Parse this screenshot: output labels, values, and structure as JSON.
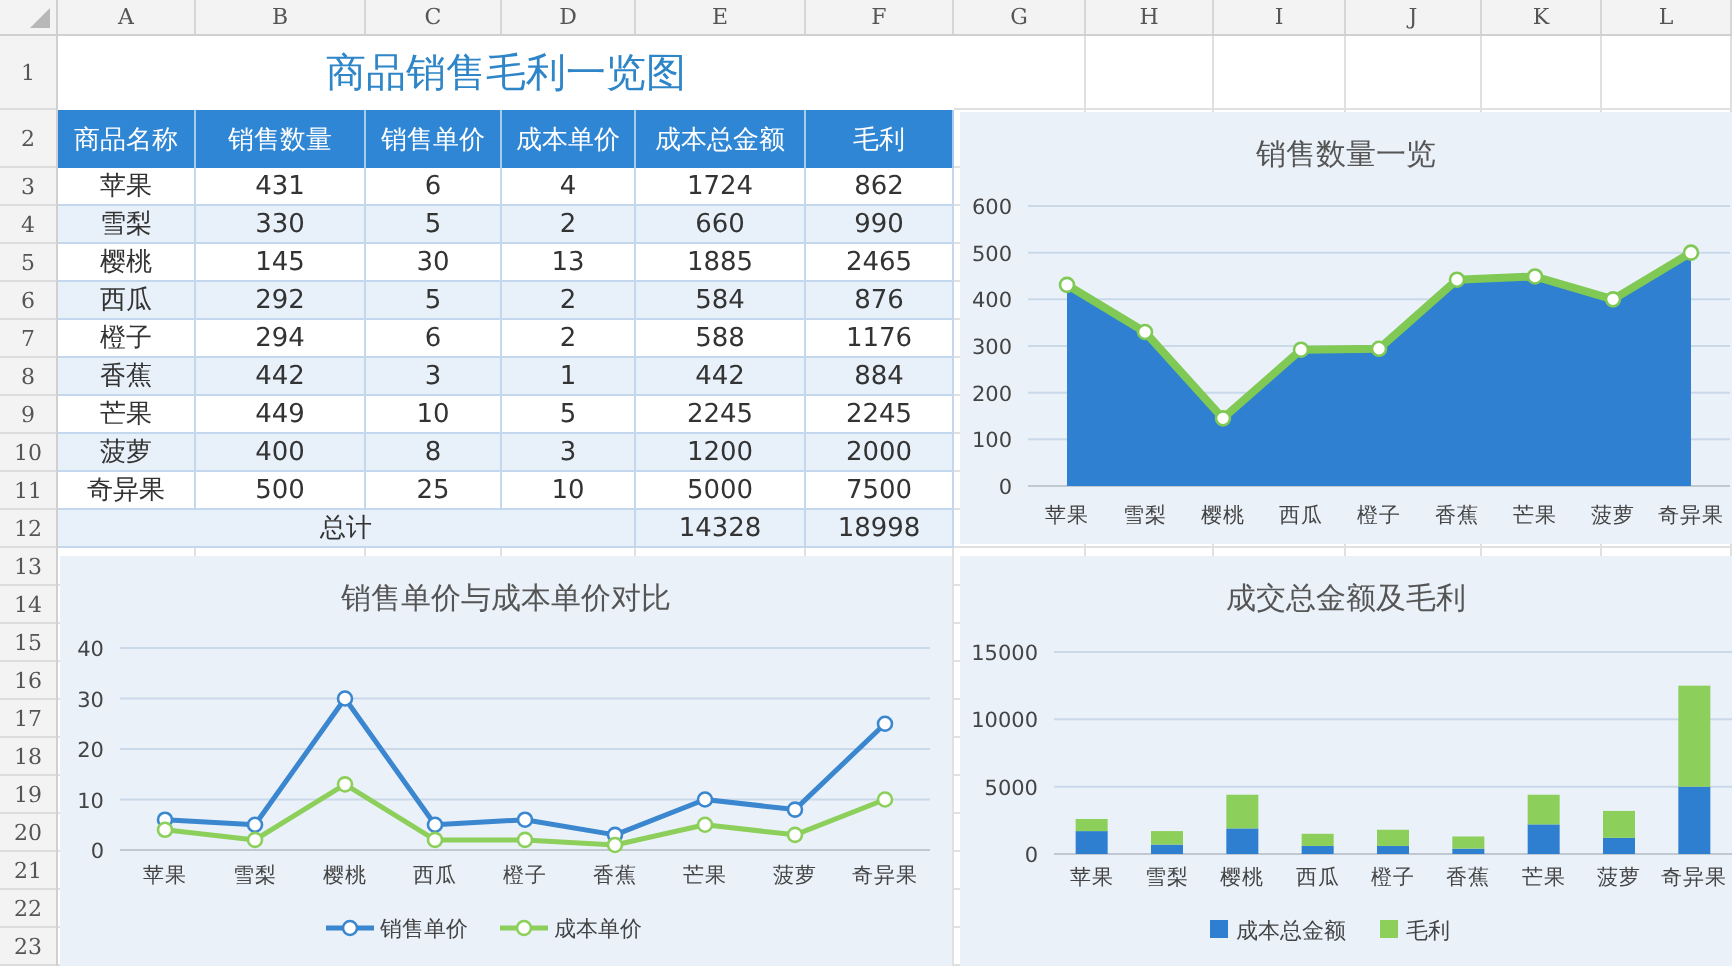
{
  "column_headers": [
    "A",
    "B",
    "C",
    "D",
    "E",
    "F",
    "G",
    "H",
    "I",
    "J",
    "K",
    "L"
  ],
  "row_headers": [
    "1",
    "2",
    "3",
    "4",
    "5",
    "6",
    "7",
    "8",
    "9",
    "10",
    "11",
    "12",
    "13",
    "14",
    "15",
    "16",
    "17",
    "18",
    "19",
    "20",
    "21",
    "22",
    "23"
  ],
  "sheet_title": "商品销售毛利一览图",
  "table": {
    "columns": [
      "商品名称",
      "销售数量",
      "销售单价",
      "成本单价",
      "成本总金额",
      "毛利"
    ],
    "rows": [
      [
        "苹果",
        "431",
        "6",
        "4",
        "1724",
        "862"
      ],
      [
        "雪梨",
        "330",
        "5",
        "2",
        "660",
        "990"
      ],
      [
        "樱桃",
        "145",
        "30",
        "13",
        "1885",
        "2465"
      ],
      [
        "西瓜",
        "292",
        "5",
        "2",
        "584",
        "876"
      ],
      [
        "橙子",
        "294",
        "6",
        "2",
        "588",
        "1176"
      ],
      [
        "香蕉",
        "442",
        "3",
        "1",
        "442",
        "884"
      ],
      [
        "芒果",
        "449",
        "10",
        "5",
        "2245",
        "2245"
      ],
      [
        "菠萝",
        "400",
        "8",
        "3",
        "1200",
        "2000"
      ],
      [
        "奇异果",
        "500",
        "25",
        "10",
        "5000",
        "7500"
      ]
    ],
    "total": {
      "label": "总计",
      "values": [
        "14328",
        "18998"
      ]
    }
  },
  "charts": [
    {
      "chart_data": {
        "type": "area",
        "title": "销售数量一览",
        "grid": true,
        "categories": [
          "苹果",
          "雪梨",
          "樱桃",
          "西瓜",
          "橙子",
          "香蕉",
          "芒果",
          "菠萝",
          "奇异果"
        ],
        "ylim": [
          0,
          600
        ],
        "yticks": [
          0,
          100,
          200,
          300,
          400,
          500,
          600
        ],
        "series": [
          {
            "type": "area",
            "color": "#2f80d1",
            "values": [
              431,
              330,
              145,
              292,
              294,
              442,
              449,
              400,
              500
            ]
          },
          {
            "type": "line",
            "marker": "circle",
            "color": "#7fc954",
            "values": [
              431,
              330,
              145,
              292,
              294,
              442,
              449,
              400,
              500
            ]
          }
        ]
      }
    },
    {
      "chart_data": {
        "type": "line",
        "title": "销售单价与成本单价对比",
        "grid": true,
        "legend": "bottom",
        "categories": [
          "苹果",
          "雪梨",
          "樱桃",
          "西瓜",
          "橙子",
          "香蕉",
          "芒果",
          "菠萝",
          "奇异果"
        ],
        "ylim": [
          0,
          40
        ],
        "yticks": [
          0,
          10,
          20,
          30,
          40
        ],
        "series": [
          {
            "name": "销售单价",
            "marker": "circle",
            "color": "#3a86cf",
            "values": [
              6,
              5,
              30,
              5,
              6,
              3,
              10,
              8,
              25
            ]
          },
          {
            "name": "成本单价",
            "marker": "circle",
            "color": "#8ccf5a",
            "values": [
              4,
              2,
              13,
              2,
              2,
              1,
              5,
              3,
              10
            ]
          }
        ]
      }
    },
    {
      "chart_data": {
        "type": "bar",
        "title": "成交总金额及毛利",
        "grid": true,
        "legend": "bottom",
        "stacked": true,
        "categories": [
          "苹果",
          "雪梨",
          "樱桃",
          "西瓜",
          "橙子",
          "香蕉",
          "芒果",
          "菠萝",
          "奇异果"
        ],
        "ylim": [
          0,
          15000
        ],
        "yticks": [
          0,
          5000,
          10000,
          15000
        ],
        "series": [
          {
            "name": "成本总金额",
            "color": "#2e7fd0",
            "values": [
              1700,
              700,
              1900,
              600,
              600,
              400,
              2200,
              1200,
              5000
            ]
          },
          {
            "name": "毛利",
            "color": "#8ccf5a",
            "values": [
              900,
              1000,
              2500,
              900,
              1200,
              900,
              2200,
              2000,
              7500
            ]
          }
        ]
      }
    }
  ]
}
